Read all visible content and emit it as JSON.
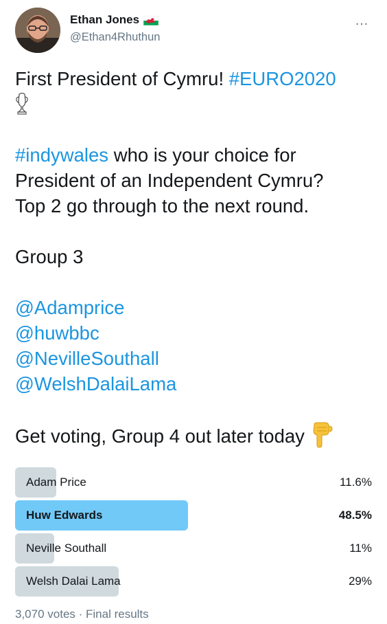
{
  "author": {
    "name": "Ethan Jones",
    "handle": "@Ethan4Rhuthun",
    "flag_icon": "wales-flag-icon",
    "more_icon": "…"
  },
  "tweet": {
    "line1_text": "First President of Cymru! ",
    "line1_hashtag": "#EURO2020",
    "trophy_icon": "trophy-icon",
    "para2_hashtag": "#indywales",
    "para2_line1_rest": " who is your choice for",
    "para2_line2": "President of an Independent Cymru?",
    "para2_line3": "Top 2 go through to the next round.",
    "group": "Group 3",
    "mentions": [
      "@Adamprice",
      "@huwbbc",
      "@NevilleSouthall",
      "@WelshDalaiLama"
    ],
    "closing": "Get voting, Group 4 out later today",
    "closing_emoji": "pointing-down-hand-icon"
  },
  "poll": {
    "options": [
      {
        "label": "Adam Price",
        "percent_text": "11.6%",
        "percent": 11.6,
        "winner": false
      },
      {
        "label": "Huw Edwards",
        "percent_text": "48.5%",
        "percent": 48.5,
        "winner": true
      },
      {
        "label": "Neville Southall",
        "percent_text": "11%",
        "percent": 11,
        "winner": false
      },
      {
        "label": "Welsh Dalai Lama",
        "percent_text": "29%",
        "percent": 29,
        "winner": false
      }
    ],
    "votes": "3,070 votes",
    "separator": " · ",
    "status": "Final results",
    "colors": {
      "winner_bar": "#71c9f8",
      "bar": "#cfd9de"
    }
  }
}
